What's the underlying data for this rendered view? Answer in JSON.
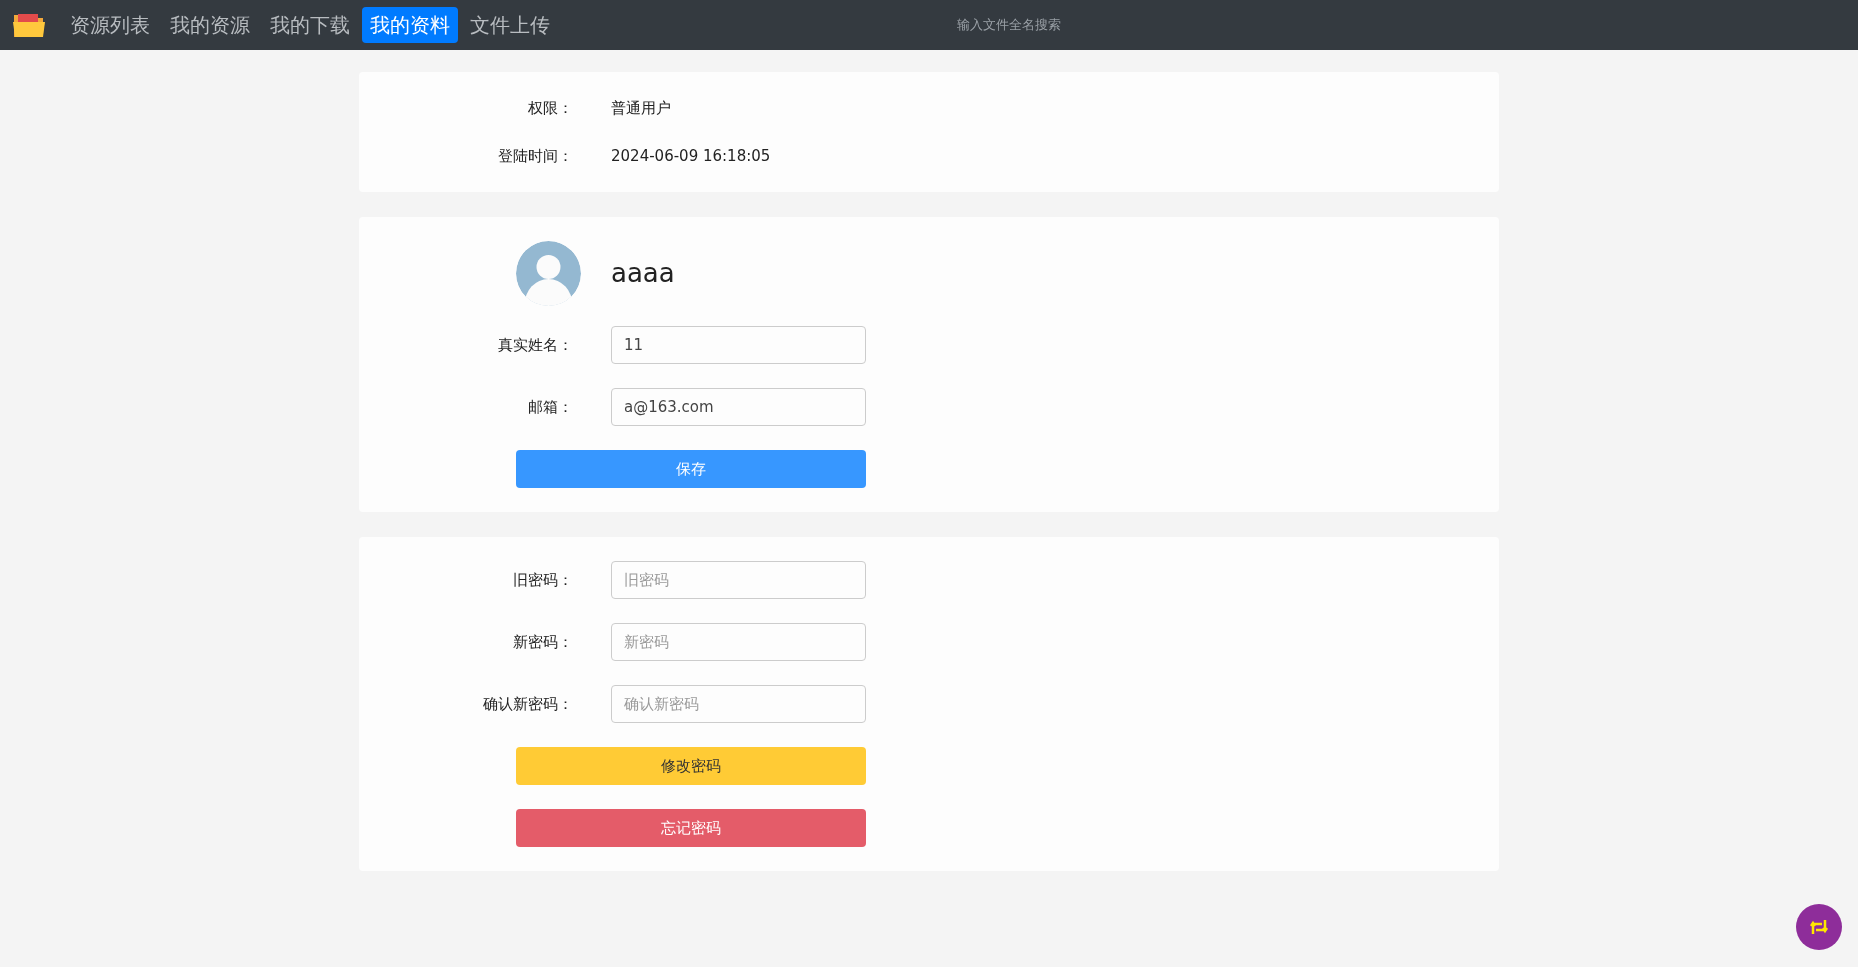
{
  "nav": {
    "tabs": [
      {
        "label": "资源列表",
        "selected": false
      },
      {
        "label": "我的资源",
        "selected": false
      },
      {
        "label": "我的下载",
        "selected": false
      },
      {
        "label": "我的资料",
        "selected": true
      },
      {
        "label": "文件上传",
        "selected": false
      }
    ],
    "search": {
      "placeholder": "输入文件全名搜索"
    }
  },
  "info": [
    {
      "label": "权限：",
      "value": "普通用户"
    },
    {
      "label": "登陆时间：",
      "value": "2024-06-09 16:18:05"
    }
  ],
  "profile": {
    "username": "aaaa",
    "fields": [
      {
        "label": "真实姓名：",
        "value": "11"
      },
      {
        "label": "邮箱：",
        "value": "a@163.com"
      }
    ],
    "button": "保存"
  },
  "password": {
    "fields": [
      {
        "label": "旧密码：",
        "placeholder": "旧密码"
      },
      {
        "label": "新密码：",
        "placeholder": "新密码"
      },
      {
        "label": "确认新密码：",
        "placeholder": "确认新密码"
      }
    ],
    "buttons": [
      {
        "label": "修改密码",
        "kind": "warning"
      },
      {
        "label": "忘记密码",
        "kind": "danger"
      }
    ]
  }
}
